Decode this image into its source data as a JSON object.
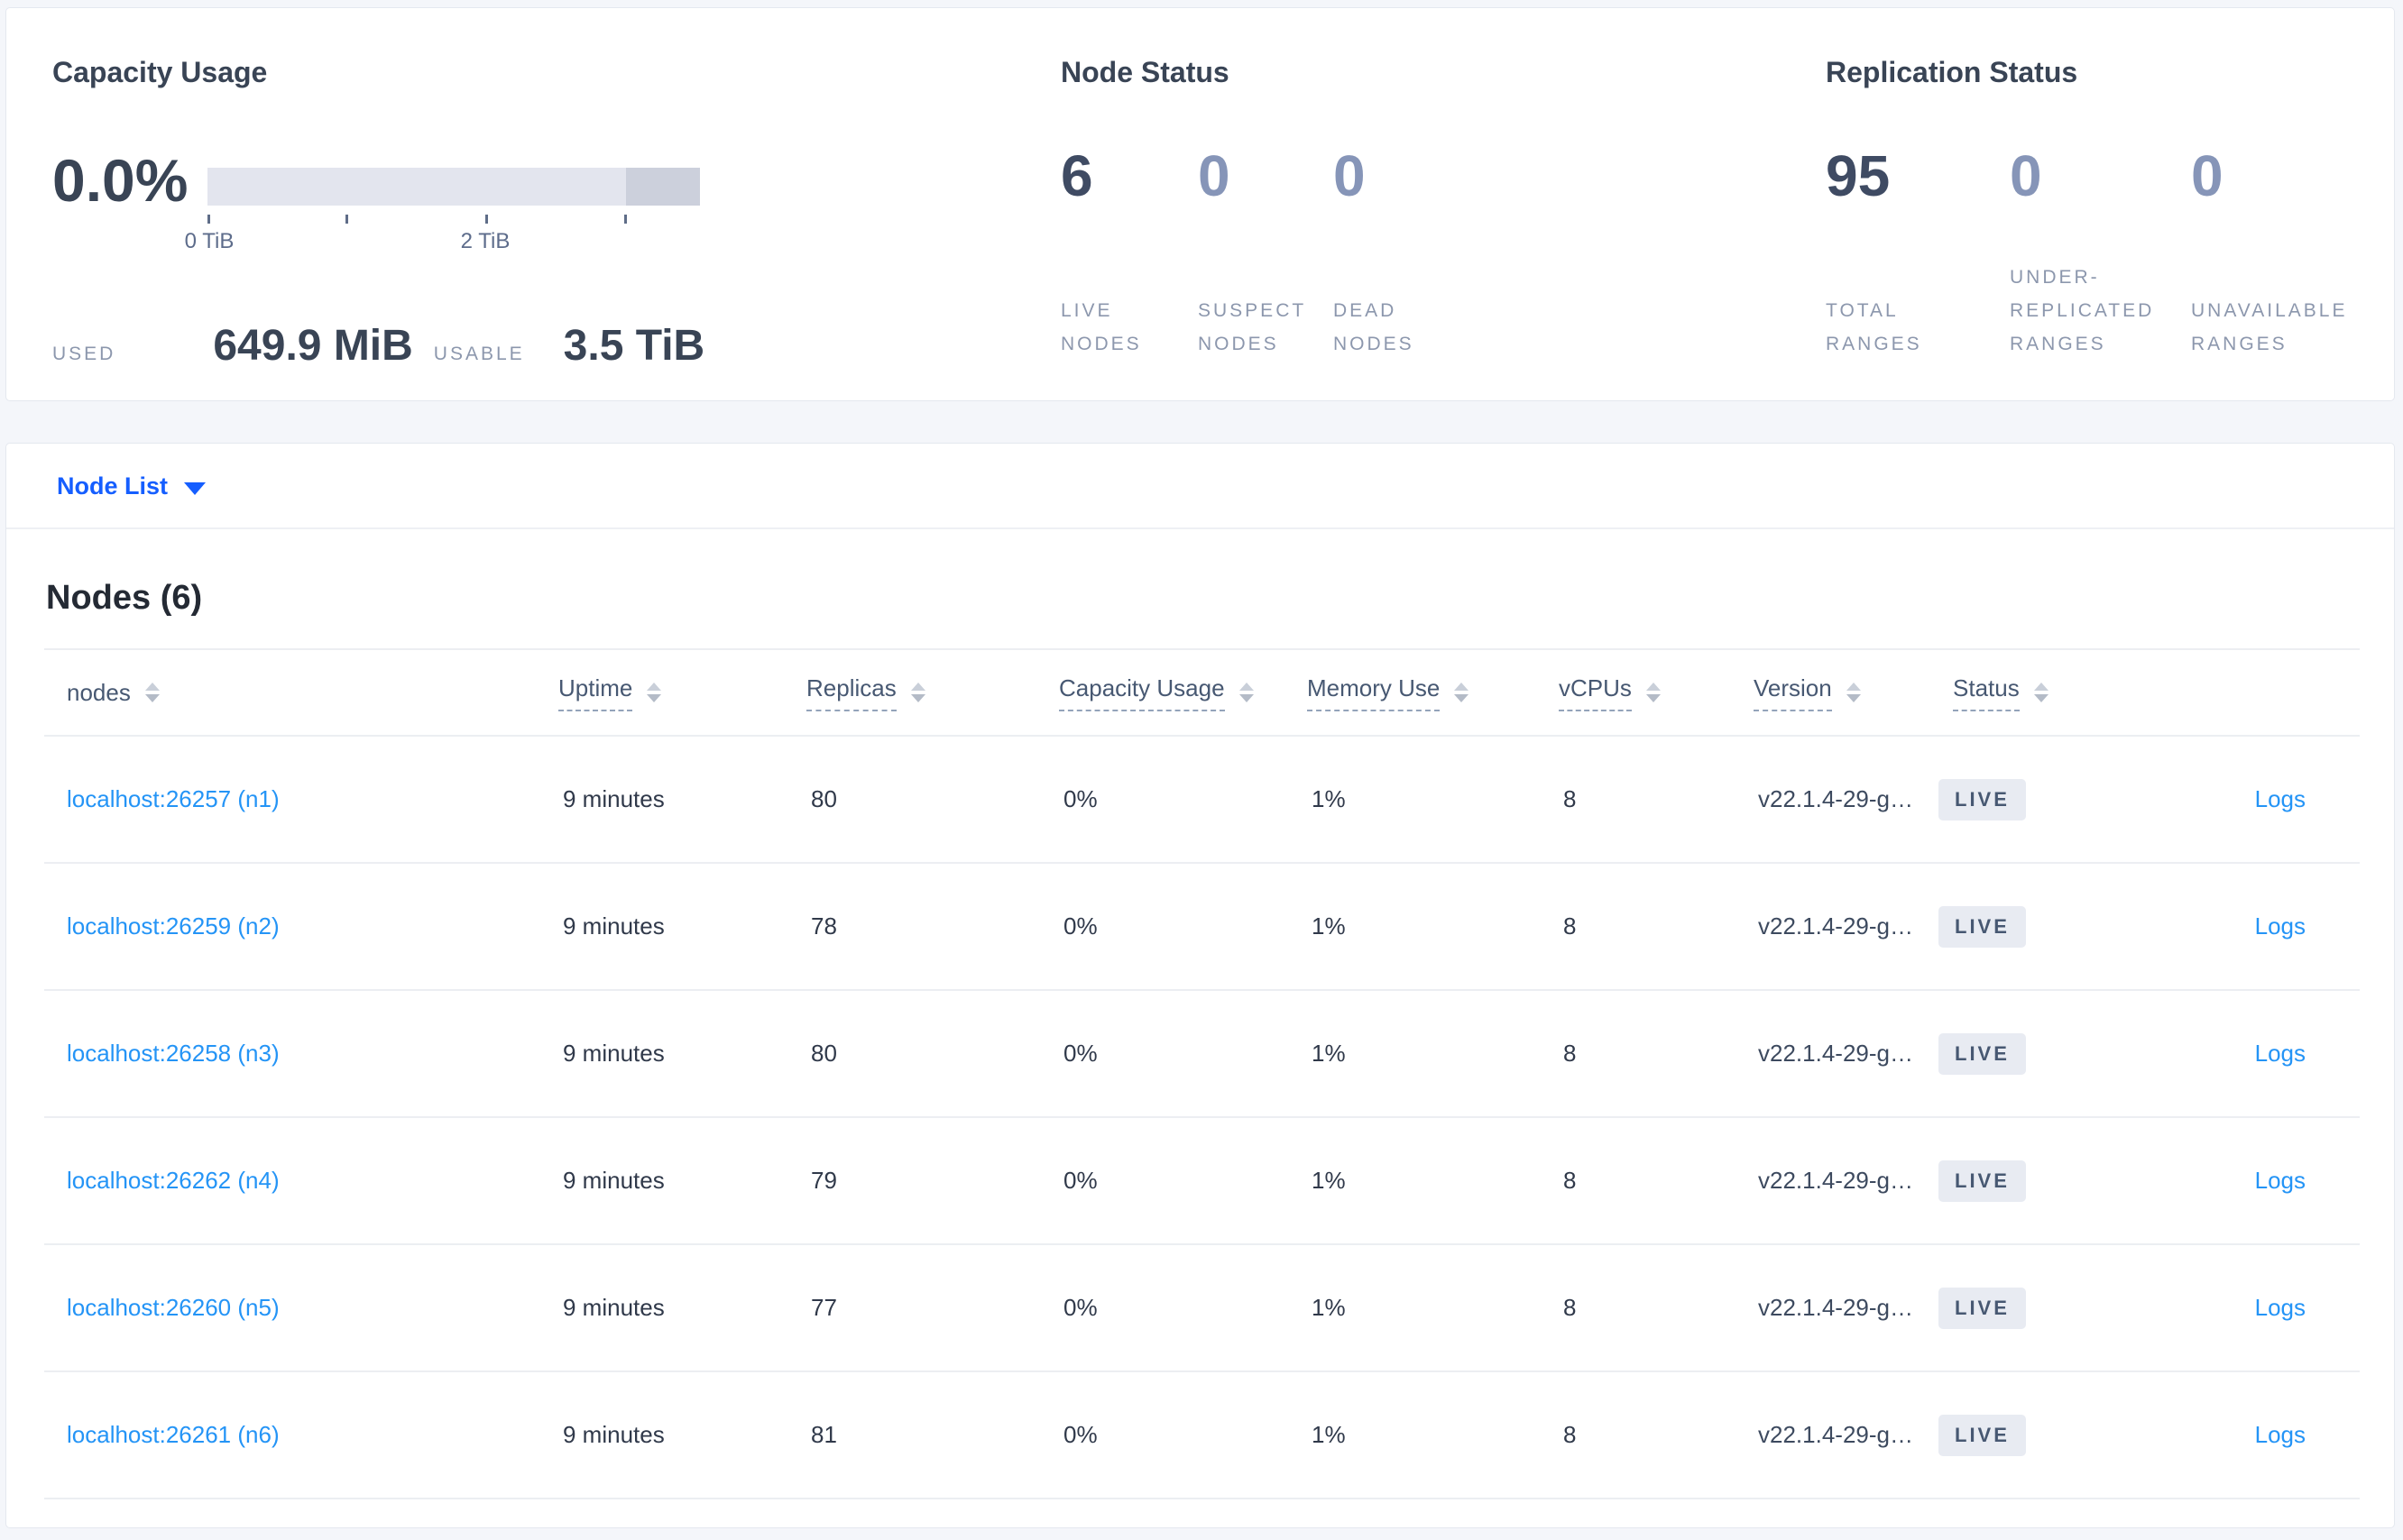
{
  "colors": {
    "page_bg": "#f4f6fa",
    "accent_blue": "#155eff",
    "link_blue": "#2494f6",
    "heading": "#394455",
    "stat_strong": "#3f4b63",
    "stat_dim": "#8695b8",
    "muted_label": "#8c97ad",
    "badge_bg": "#e8ebf2",
    "badge_text": "#475872",
    "gauge_light": "#e3e5ee",
    "gauge_dark": "#ccd0dc"
  },
  "summary": {
    "capacity": {
      "title": "Capacity Usage",
      "percent": "0.0%",
      "ticks": [
        "0 TiB",
        "2 TiB"
      ],
      "used_label": "USED",
      "used_value": "649.9 MiB",
      "usable_label": "USABLE",
      "usable_value": "3.5 TiB",
      "bar": {
        "light_pct": 85,
        "dark_pct": 15,
        "scale_max_tib": 3.5
      }
    },
    "node_status": {
      "title": "Node Status",
      "stats": [
        {
          "value": "6",
          "lines": [
            "LIVE",
            "NODES"
          ]
        },
        {
          "value": "0",
          "lines": [
            "SUSPECT",
            "NODES"
          ]
        },
        {
          "value": "0",
          "lines": [
            "DEAD",
            "NODES"
          ]
        }
      ]
    },
    "replication_status": {
      "title": "Replication Status",
      "stats": [
        {
          "value": "95",
          "lines": [
            "TOTAL",
            "RANGES"
          ]
        },
        {
          "value": "0",
          "lines": [
            "UNDER-",
            "REPLICATED",
            "RANGES"
          ]
        },
        {
          "value": "0",
          "lines": [
            "UNAVAILABLE",
            "RANGES"
          ]
        }
      ]
    }
  },
  "view_selector": {
    "label": "Node List"
  },
  "nodes_table": {
    "title": "Nodes (6)",
    "columns": [
      "nodes",
      "Uptime",
      "Replicas",
      "Capacity Usage",
      "Memory Use",
      "vCPUs",
      "Version",
      "Status"
    ],
    "logs_label": "Logs",
    "rows": [
      {
        "node": "localhost:26257 (n1)",
        "uptime": "9 minutes",
        "replicas": "80",
        "capacity": "0%",
        "memory": "1%",
        "vcpus": "8",
        "version": "v22.1.4-29-g…",
        "status": "LIVE"
      },
      {
        "node": "localhost:26259 (n2)",
        "uptime": "9 minutes",
        "replicas": "78",
        "capacity": "0%",
        "memory": "1%",
        "vcpus": "8",
        "version": "v22.1.4-29-g…",
        "status": "LIVE"
      },
      {
        "node": "localhost:26258 (n3)",
        "uptime": "9 minutes",
        "replicas": "80",
        "capacity": "0%",
        "memory": "1%",
        "vcpus": "8",
        "version": "v22.1.4-29-g…",
        "status": "LIVE"
      },
      {
        "node": "localhost:26262 (n4)",
        "uptime": "9 minutes",
        "replicas": "79",
        "capacity": "0%",
        "memory": "1%",
        "vcpus": "8",
        "version": "v22.1.4-29-g…",
        "status": "LIVE"
      },
      {
        "node": "localhost:26260 (n5)",
        "uptime": "9 minutes",
        "replicas": "77",
        "capacity": "0%",
        "memory": "1%",
        "vcpus": "8",
        "version": "v22.1.4-29-g…",
        "status": "LIVE"
      },
      {
        "node": "localhost:26261 (n6)",
        "uptime": "9 minutes",
        "replicas": "81",
        "capacity": "0%",
        "memory": "1%",
        "vcpus": "8",
        "version": "v22.1.4-29-g…",
        "status": "LIVE"
      }
    ]
  }
}
